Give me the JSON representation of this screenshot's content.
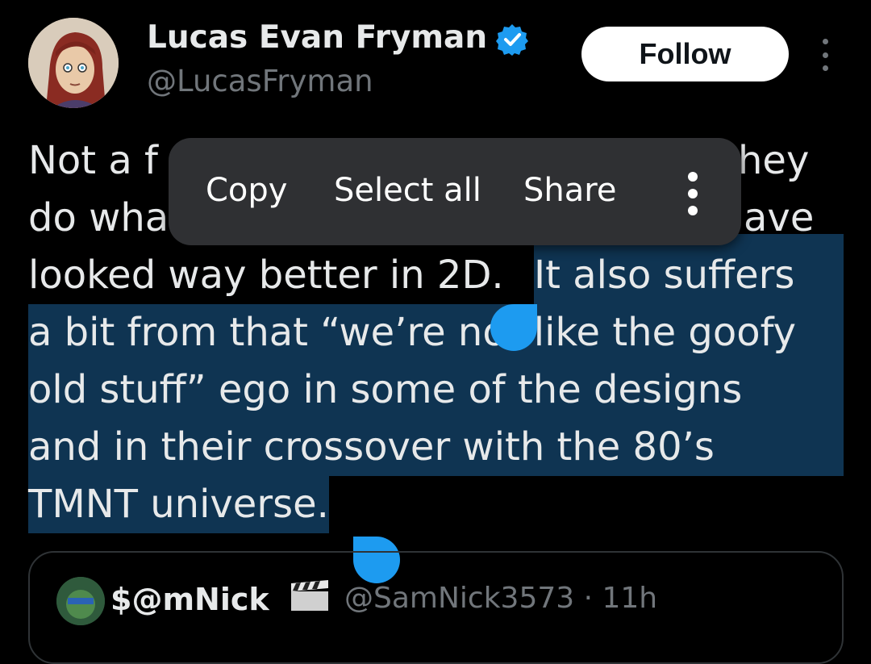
{
  "author": {
    "name": "Lucas Evan Fryman",
    "handle": "@LucasFryman",
    "verified": true
  },
  "actions": {
    "follow_label": "Follow",
    "more_icon": "more-vertical-icon"
  },
  "tweet": {
    "lines": [
      [
        "Not a f",
        "hey"
      ],
      [
        "do wha",
        "ave"
      ],
      [
        "looked way better in 2D. ",
        "It also suffers"
      ],
      [
        "a bit from that “we’re not like the goofy"
      ],
      [
        "old stuff” ego in some of the designs"
      ],
      [
        "and in their crossover with the 80’s"
      ],
      [
        "TMNT universe."
      ]
    ]
  },
  "context_menu": {
    "items": [
      "Copy",
      "Select all",
      "Share"
    ],
    "more_icon": "more-vertical-icon"
  },
  "quoted": {
    "name": "$@mNick",
    "emoji": "clapperboard",
    "handle_time": "@SamNick3573 · 11h"
  },
  "colors": {
    "accent": "#1d9bf0",
    "selection": "#0f3452",
    "menu_bg": "#2f3033",
    "text": "#e7e9ea",
    "secondary": "#71767b"
  }
}
